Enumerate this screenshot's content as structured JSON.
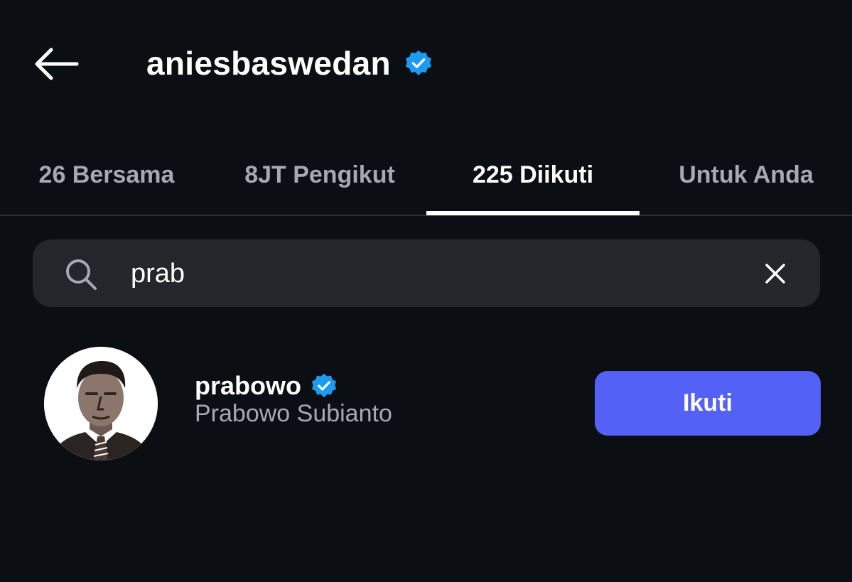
{
  "header": {
    "title": "aniesbaswedan",
    "back_icon": "arrow-left-icon",
    "verified_icon": "verified-badge-icon"
  },
  "tabs": [
    {
      "label": "26 Bersama",
      "active": false
    },
    {
      "label": "8JT Pengikut",
      "active": false
    },
    {
      "label": "225 Diikuti",
      "active": true
    },
    {
      "label": "Untuk Anda",
      "active": false
    }
  ],
  "search": {
    "value": "prab",
    "icon": "search-icon",
    "clear_icon": "close-icon"
  },
  "results": [
    {
      "username": "prabowo",
      "display_name": "Prabowo Subianto",
      "verified": true,
      "follow_label": "Ikuti"
    }
  ],
  "colors": {
    "background": "#0b0f14",
    "accent": "#5361f6",
    "verified": "#1d9bf0",
    "muted_text": "#a6aab0",
    "search_bg": "#23262b"
  }
}
